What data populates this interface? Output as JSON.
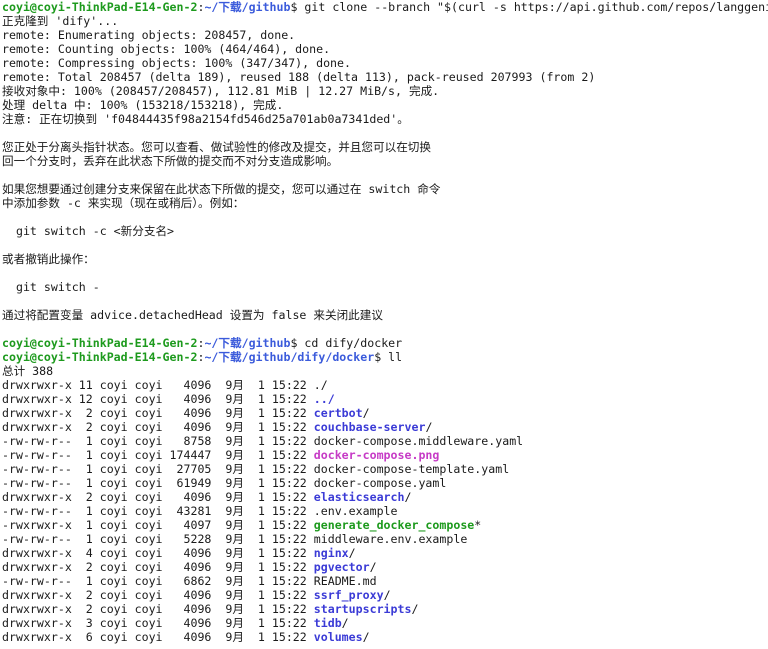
{
  "terminal": {
    "prompt_user": "coyi@coyi-ThinkPad-E14-Gen-2",
    "lines": [
      {
        "type": "prompt",
        "path": "~/下载/github",
        "cmd": " git clone --branch \"$(curl -s https://api.github.com/repos/langgenius/dify/releases/latest | jq -r .tag_name)\" https://github.com/langgenius/dify.git"
      },
      {
        "type": "text",
        "text": "正克隆到 'dify'..."
      },
      {
        "type": "text",
        "text": "remote: Enumerating objects: 208457, done."
      },
      {
        "type": "text",
        "text": "remote: Counting objects: 100% (464/464), done."
      },
      {
        "type": "text",
        "text": "remote: Compressing objects: 100% (347/347), done."
      },
      {
        "type": "text",
        "text": "remote: Total 208457 (delta 189), reused 188 (delta 113), pack-reused 207993 (from 2)"
      },
      {
        "type": "text",
        "text": "接收对象中: 100% (208457/208457), 112.81 MiB | 12.27 MiB/s, 完成."
      },
      {
        "type": "text",
        "text": "处理 delta 中: 100% (153218/153218), 完成."
      },
      {
        "type": "text",
        "text": "注意: 正在切换到 'f04844435f98a2154fd546d25a701ab0a7341ded'。"
      },
      {
        "type": "text",
        "text": ""
      },
      {
        "type": "text",
        "text": "您正处于分离头指针状态。您可以查看、做试验性的修改及提交，并且您可以在切换"
      },
      {
        "type": "text",
        "text": "回一个分支时，丢弃在此状态下所做的提交而不对分支造成影响。"
      },
      {
        "type": "text",
        "text": ""
      },
      {
        "type": "text",
        "text": "如果您想要通过创建分支来保留在此状态下所做的提交，您可以通过在 switch 命令"
      },
      {
        "type": "text",
        "text": "中添加参数 -c 来实现（现在或稍后）。例如："
      },
      {
        "type": "text",
        "text": ""
      },
      {
        "type": "text",
        "text": "  git switch -c <新分支名>"
      },
      {
        "type": "text",
        "text": ""
      },
      {
        "type": "text",
        "text": "或者撤销此操作："
      },
      {
        "type": "text",
        "text": ""
      },
      {
        "type": "text",
        "text": "  git switch -"
      },
      {
        "type": "text",
        "text": ""
      },
      {
        "type": "text",
        "text": "通过将配置变量 advice.detachedHead 设置为 false 来关闭此建议"
      },
      {
        "type": "text",
        "text": ""
      },
      {
        "type": "prompt",
        "path": "~/下载/github",
        "cmd": " cd dify/docker"
      },
      {
        "type": "prompt",
        "path": "~/下载/github/dify/docker",
        "cmd": " ll"
      },
      {
        "type": "text",
        "text": "总计 388"
      },
      {
        "type": "ls",
        "meta": "drwxrwxr-x 11 coyi coyi   4096  9月  1 15:22 ",
        "name": "./",
        "kind": "plain"
      },
      {
        "type": "ls",
        "meta": "drwxrwxr-x 12 coyi coyi   4096  9月  1 15:22 ",
        "name": "../",
        "kind": "dir"
      },
      {
        "type": "ls",
        "meta": "drwxrwxr-x  2 coyi coyi   4096  9月  1 15:22 ",
        "name": "certbot",
        "suffix": "/",
        "kind": "dir"
      },
      {
        "type": "ls",
        "meta": "drwxrwxr-x  2 coyi coyi   4096  9月  1 15:22 ",
        "name": "couchbase-server",
        "suffix": "/",
        "kind": "dir"
      },
      {
        "type": "ls",
        "meta": "-rw-rw-r--  1 coyi coyi   8758  9月  1 15:22 ",
        "name": "docker-compose.middleware.yaml",
        "kind": "plain"
      },
      {
        "type": "ls",
        "meta": "-rw-rw-r--  1 coyi coyi 174447  9月  1 15:22 ",
        "name": "docker-compose.png",
        "kind": "img"
      },
      {
        "type": "ls",
        "meta": "-rw-rw-r--  1 coyi coyi  27705  9月  1 15:22 ",
        "name": "docker-compose-template.yaml",
        "kind": "plain"
      },
      {
        "type": "ls",
        "meta": "-rw-rw-r--  1 coyi coyi  61949  9月  1 15:22 ",
        "name": "docker-compose.yaml",
        "kind": "plain"
      },
      {
        "type": "ls",
        "meta": "drwxrwxr-x  2 coyi coyi   4096  9月  1 15:22 ",
        "name": "elasticsearch",
        "suffix": "/",
        "kind": "dir"
      },
      {
        "type": "ls",
        "meta": "-rw-rw-r--  1 coyi coyi  43281  9月  1 15:22 ",
        "name": ".env.example",
        "kind": "plain"
      },
      {
        "type": "ls",
        "meta": "-rwxrwxr-x  1 coyi coyi   4097  9月  1 15:22 ",
        "name": "generate_docker_compose",
        "suffix": "*",
        "kind": "exe"
      },
      {
        "type": "ls",
        "meta": "-rw-rw-r--  1 coyi coyi   5228  9月  1 15:22 ",
        "name": "middleware.env.example",
        "kind": "plain"
      },
      {
        "type": "ls",
        "meta": "drwxrwxr-x  4 coyi coyi   4096  9月  1 15:22 ",
        "name": "nginx",
        "suffix": "/",
        "kind": "dir"
      },
      {
        "type": "ls",
        "meta": "drwxrwxr-x  2 coyi coyi   4096  9月  1 15:22 ",
        "name": "pgvector",
        "suffix": "/",
        "kind": "dir"
      },
      {
        "type": "ls",
        "meta": "-rw-rw-r--  1 coyi coyi   6862  9月  1 15:22 ",
        "name": "README.md",
        "kind": "plain"
      },
      {
        "type": "ls",
        "meta": "drwxrwxr-x  2 coyi coyi   4096  9月  1 15:22 ",
        "name": "ssrf_proxy",
        "suffix": "/",
        "kind": "dir"
      },
      {
        "type": "ls",
        "meta": "drwxrwxr-x  2 coyi coyi   4096  9月  1 15:22 ",
        "name": "startupscripts",
        "suffix": "/",
        "kind": "dir"
      },
      {
        "type": "ls",
        "meta": "drwxrwxr-x  3 coyi coyi   4096  9月  1 15:22 ",
        "name": "tidb",
        "suffix": "/",
        "kind": "dir"
      },
      {
        "type": "ls",
        "meta": "drwxrwxr-x  6 coyi coyi   4096  9月  1 15:22 ",
        "name": "volumes",
        "suffix": "/",
        "kind": "dir"
      }
    ]
  }
}
